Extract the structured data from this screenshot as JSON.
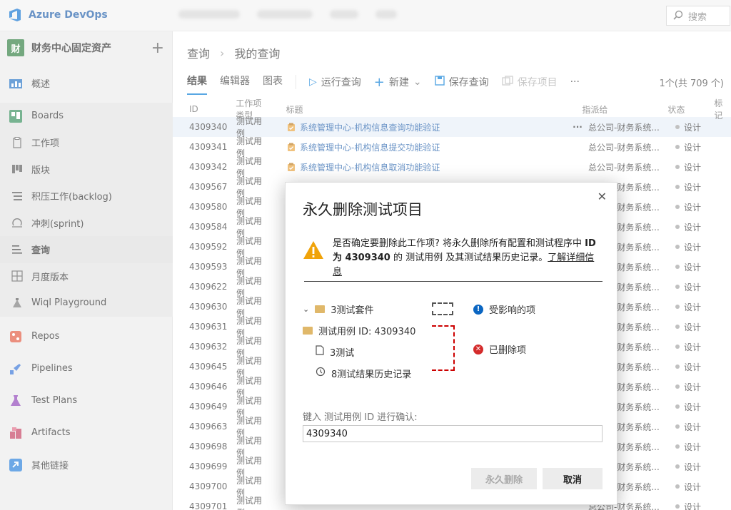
{
  "app": {
    "name": "Azure DevOps"
  },
  "header": {
    "search_placeholder": "搜索"
  },
  "project": {
    "name": "财务中心固定资产",
    "avatar_letter": "财"
  },
  "sidebar": {
    "items": [
      {
        "label": "概述",
        "icon": "overview-icon"
      },
      {
        "label": "Boards",
        "icon": "boards-icon"
      },
      {
        "label": "工作项",
        "icon": "work-items-icon"
      },
      {
        "label": "版块",
        "icon": "board-icon"
      },
      {
        "label": "积压工作(backlog)",
        "icon": "backlog-icon"
      },
      {
        "label": "冲刺(sprint)",
        "icon": "sprint-icon"
      },
      {
        "label": "查询",
        "icon": "queries-icon"
      },
      {
        "label": "月度版本",
        "icon": "delivery-plans-icon"
      },
      {
        "label": "Wiql Playground",
        "icon": "wiql-icon"
      },
      {
        "label": "Repos",
        "icon": "repos-icon"
      },
      {
        "label": "Pipelines",
        "icon": "pipelines-icon"
      },
      {
        "label": "Test Plans",
        "icon": "test-plans-icon"
      },
      {
        "label": "Artifacts",
        "icon": "artifacts-icon"
      },
      {
        "label": "其他链接",
        "icon": "link-icon"
      }
    ]
  },
  "page": {
    "breadcrumb_root": "查询",
    "breadcrumb_current": "我的查询",
    "tabs": [
      "结果",
      "编辑器",
      "图表"
    ],
    "toolbar": {
      "run": "运行查询",
      "new": "新建",
      "save_query": "保存查询",
      "save_items": "保存项目",
      "more": "···"
    },
    "count": "1个(共 709 个)"
  },
  "table": {
    "headers": [
      "ID",
      "工作项类型",
      "标题",
      "指派给",
      "状态",
      "标记"
    ],
    "rows": [
      {
        "id": "4309340",
        "type": "测试用例",
        "title": "系统管理中心-机构信息查询功能验证",
        "assign": "总公司-财务系统...",
        "state": "设计"
      },
      {
        "id": "4309341",
        "type": "测试用例",
        "title": "系统管理中心-机构信息提交功能验证",
        "assign": "总公司-财务系统...",
        "state": "设计"
      },
      {
        "id": "4309342",
        "type": "测试用例",
        "title": "系统管理中心-机构信息取消功能验证",
        "assign": "总公司-财务系统...",
        "state": "设计"
      },
      {
        "id": "4309567",
        "type": "测试用例",
        "title": "",
        "assign": "总公司-财务系统...",
        "state": "设计"
      },
      {
        "id": "4309580",
        "type": "测试用例",
        "title": "",
        "assign": "总公司-财务系统...",
        "state": "设计"
      },
      {
        "id": "4309584",
        "type": "测试用例",
        "title": "",
        "assign": "总公司-财务系统...",
        "state": "设计"
      },
      {
        "id": "4309592",
        "type": "测试用例",
        "title": "",
        "assign": "总公司-财务系统...",
        "state": "设计"
      },
      {
        "id": "4309593",
        "type": "测试用例",
        "title": "",
        "assign": "总公司-财务系统...",
        "state": "设计"
      },
      {
        "id": "4309622",
        "type": "测试用例",
        "title": "",
        "assign": "总公司-财务系统...",
        "state": "设计"
      },
      {
        "id": "4309630",
        "type": "测试用例",
        "title": "",
        "assign": "总公司-财务系统...",
        "state": "设计"
      },
      {
        "id": "4309631",
        "type": "测试用例",
        "title": "",
        "assign": "总公司-财务系统...",
        "state": "设计"
      },
      {
        "id": "4309632",
        "type": "测试用例",
        "title": "",
        "assign": "总公司-财务系统...",
        "state": "设计"
      },
      {
        "id": "4309645",
        "type": "测试用例",
        "title": "",
        "assign": "总公司-财务系统...",
        "state": "设计"
      },
      {
        "id": "4309646",
        "type": "测试用例",
        "title": "",
        "assign": "总公司-财务系统...",
        "state": "设计"
      },
      {
        "id": "4309649",
        "type": "测试用例",
        "title": "",
        "assign": "总公司-财务系统...",
        "state": "设计"
      },
      {
        "id": "4309663",
        "type": "测试用例",
        "title": "",
        "assign": "总公司-财务系统...",
        "state": "设计"
      },
      {
        "id": "4309698",
        "type": "测试用例",
        "title": "",
        "assign": "总公司-财务系统...",
        "state": "设计"
      },
      {
        "id": "4309699",
        "type": "测试用例",
        "title": "",
        "assign": "总公司-财务系统...",
        "state": "设计"
      },
      {
        "id": "4309700",
        "type": "测试用例",
        "title": "",
        "assign": "总公司-财务系统...",
        "state": "设计"
      },
      {
        "id": "4309701",
        "type": "测试用例",
        "title": "",
        "assign": "总公司-财务系统...",
        "state": "设计"
      }
    ]
  },
  "dialog": {
    "title": "永久删除测试项目",
    "warning_part1": "是否确定要删除此工作项? 将永久删除所有配置和测试程序中 ",
    "warning_bold": "ID 为 4309340",
    "warning_part2": " 的 测试用例 及其测试结果历史记录。",
    "learn_more": "了解详细信息",
    "tree": {
      "suite": "3测试套件",
      "test_case": "测试用例 ID: 4309340",
      "tests": "3测试",
      "history": "8测试结果历史记录"
    },
    "legend": {
      "affected": "受影响的项",
      "deleted": "已删除项"
    },
    "confirm_label": "键入 测试用例 ID 进行确认:",
    "confirm_value": "4309340",
    "delete_button": "永久删除",
    "cancel_button": "取消"
  },
  "colors": {
    "accent": "#0078d4",
    "brand": "#1a5aa8",
    "danger": "#d42b2b",
    "warning": "#f0a30a"
  }
}
